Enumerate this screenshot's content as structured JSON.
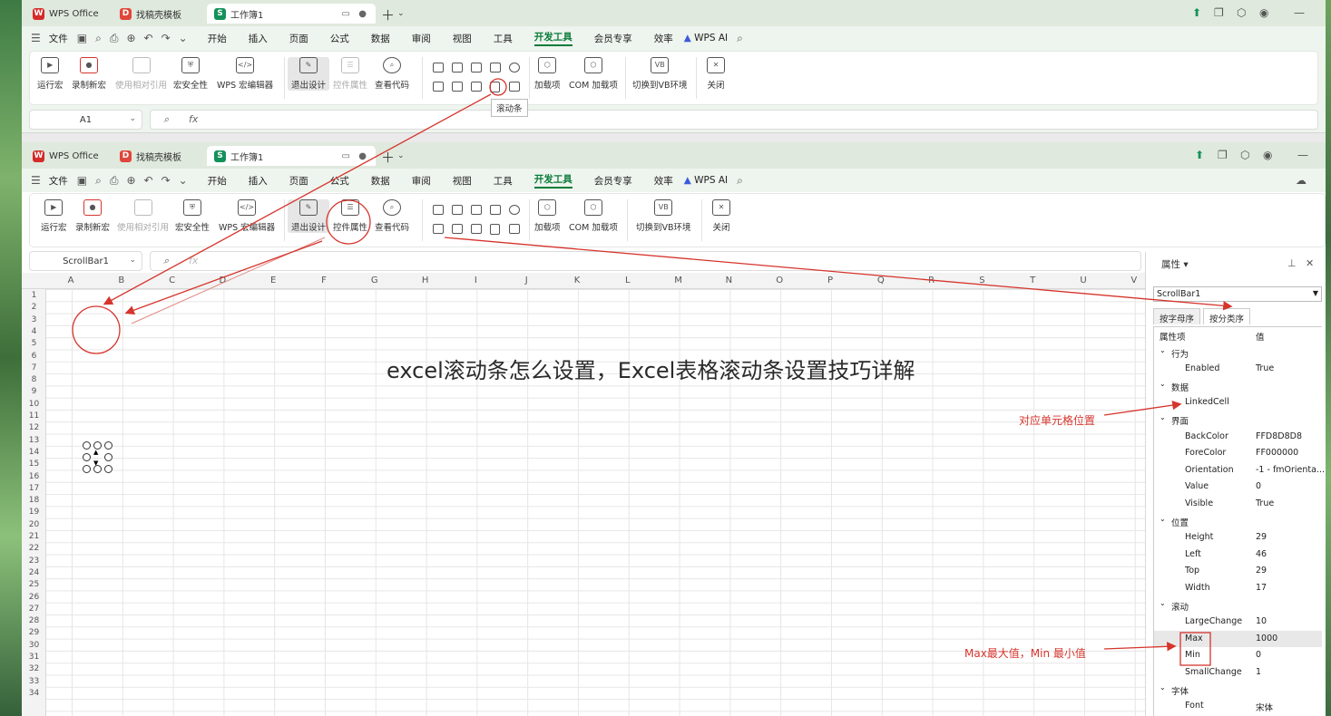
{
  "tabs": {
    "wps_office": "WPS Office",
    "template": "找稿壳模板",
    "workbook": "工作簿1"
  },
  "menu": {
    "file": "文件",
    "items": [
      "开始",
      "插入",
      "页面",
      "公式",
      "数据",
      "审阅",
      "视图",
      "工具",
      "开发工具",
      "会员专享",
      "效率"
    ],
    "wps_ai": "WPS AI"
  },
  "ribbon": {
    "run_macro": "运行宏",
    "record_macro": "录制新宏",
    "relative_ref": "使用相对引用",
    "macro_security": "宏安全性",
    "macro_editor": "WPS 宏编辑器",
    "exit_design": "退出设计",
    "control_props": "控件属性",
    "view_code": "查看代码",
    "addins": "加载项",
    "com_addins": "COM 加载项",
    "switch_vb": "切换到VB环境",
    "close": "关闭"
  },
  "tooltip": "滚动条",
  "formula_a": {
    "name_box": "A1",
    "fx": "fx"
  },
  "formula_b": {
    "name_box": "ScrollBar1",
    "fx": "fx"
  },
  "columns": [
    "A",
    "B",
    "C",
    "D",
    "E",
    "F",
    "G",
    "H",
    "I",
    "J",
    "K",
    "L",
    "M",
    "N",
    "O",
    "P",
    "Q",
    "R",
    "S",
    "T",
    "U",
    "V"
  ],
  "rows": [
    "1",
    "2",
    "3",
    "4",
    "5",
    "6",
    "7",
    "8",
    "9",
    "10",
    "11",
    "12",
    "13",
    "14",
    "15",
    "16",
    "17",
    "18",
    "19",
    "20",
    "21",
    "22",
    "23",
    "24",
    "25",
    "26",
    "27",
    "28",
    "29",
    "30",
    "31",
    "32",
    "33",
    "34"
  ],
  "properties": {
    "title": "属性",
    "object": "ScrollBar1",
    "tab_alpha": "按字母序",
    "tab_category": "按分类序",
    "header_key": "属性项",
    "header_val": "值",
    "rows": [
      {
        "type": "cat",
        "k": "行为"
      },
      {
        "type": "item",
        "k": "Enabled",
        "v": "True"
      },
      {
        "type": "cat",
        "k": "数据"
      },
      {
        "type": "item",
        "k": "LinkedCell",
        "v": ""
      },
      {
        "type": "cat",
        "k": "界面"
      },
      {
        "type": "item",
        "k": "BackColor",
        "v": "FFD8D8D8"
      },
      {
        "type": "item",
        "k": "ForeColor",
        "v": "FF000000"
      },
      {
        "type": "item",
        "k": "Orientation",
        "v": "-1 - fmOrienta..."
      },
      {
        "type": "item",
        "k": "Value",
        "v": "0"
      },
      {
        "type": "item",
        "k": "Visible",
        "v": "True"
      },
      {
        "type": "cat",
        "k": "位置"
      },
      {
        "type": "item",
        "k": "Height",
        "v": "29"
      },
      {
        "type": "item",
        "k": "Left",
        "v": "46"
      },
      {
        "type": "item",
        "k": "Top",
        "v": "29"
      },
      {
        "type": "item",
        "k": "Width",
        "v": "17"
      },
      {
        "type": "cat",
        "k": "滚动"
      },
      {
        "type": "item",
        "k": "LargeChange",
        "v": "10"
      },
      {
        "type": "item",
        "k": "Max",
        "v": "1000",
        "hl": true
      },
      {
        "type": "item",
        "k": "Min",
        "v": "0"
      },
      {
        "type": "item",
        "k": "SmallChange",
        "v": "1"
      },
      {
        "type": "cat",
        "k": "字体"
      },
      {
        "type": "item",
        "k": "Font",
        "v": "宋体"
      }
    ]
  },
  "annotations": {
    "linked_cell": "对应单元格位置",
    "max_min": "Max最大值，Min 最小值"
  },
  "watermark": "excel滚动条怎么设置，Excel表格滚动条设置技巧详解",
  "colors": {
    "accent": "#0a7c3a",
    "annotation": "#d6342c"
  }
}
